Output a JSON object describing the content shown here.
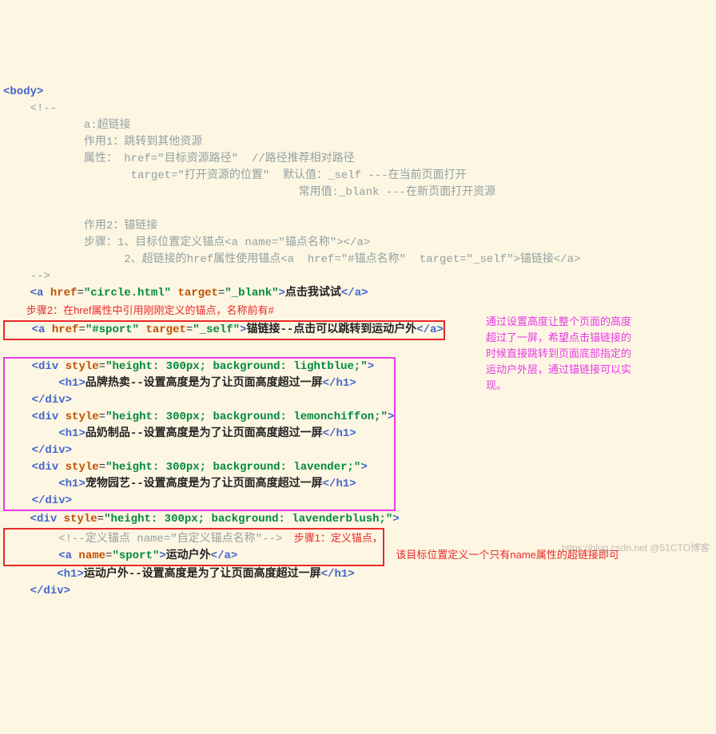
{
  "c1": "<body>",
  "cm1_l1": "    <!--",
  "cm1_l2": "            a:超链接",
  "cm1_l3": "            作用1：跳转到其他资源",
  "cm1_l4": "            属性： href=\"目标资源路径\"  //路径推荐相对路径",
  "cm1_l5": "                   target=\"打开资源的位置\"  默认值：_self ---在当前页面打开",
  "cm1_l6": "                                            常用值:_blank ---在新页面打开资源",
  "cm1_l7": " ",
  "cm1_l8": "            作用2：锚链接",
  "cm1_l9": "            步骤：1、目标位置定义锚点<a name=\"锚点名称\"></a>",
  "cm1_l10": "                  2、超链接的href属性使用锚点<a  href=\"#锚点名称\"  target=\"_self\">锚链接</a>",
  "cm1_l11": "    -->",
  "a1_pre": "    ",
  "a1_open": "<",
  "a1_tag": "a",
  "a1_attr1": " href",
  "a1_eq1": "=",
  "a1_v1": "\"circle.html\"",
  "a1_attr2": " target",
  "a1_eq2": "=",
  "a1_v2": "\"_blank\"",
  "a1_gt": ">",
  "a1_txt": "点击我试试",
  "a1_close": "</a>",
  "annot_top": "        步骤2：在href属性中引用刚刚定义的锚点，名称前有#",
  "a2_pre": "    ",
  "a2_open": "<",
  "a2_tag": "a",
  "a2_attr1": " href",
  "a2_eq1": "=",
  "a2_v1": "\"#sport\"",
  "a2_attr2": " target",
  "a2_eq2": "=",
  "a2_v2": "\"_self\"",
  "a2_gt": ">",
  "a2_txt": "锚链接--点击可以跳转到运动户外",
  "a2_close": "</a>",
  "d1_pre": "    ",
  "d1_open": "<",
  "d1_tag": "div",
  "d1_attr": " style",
  "d1_eq": "=",
  "d1_v": "\"height: 300px; background: lightblue;\"",
  "d1_gt": ">",
  "d1h_pre": "        ",
  "d1h_open": "<",
  "d1h_tag": "h1",
  "d1h_gt": ">",
  "d1h_txt": "品牌热卖--设置高度是为了让页面高度超过一屏",
  "d1h_close": "</h1>",
  "d1_close_pre": "    ",
  "d1_close": "</div>",
  "d2_pre": "    ",
  "d2_open": "<",
  "d2_tag": "div",
  "d2_attr": " style",
  "d2_eq": "=",
  "d2_v": "\"height: 300px; background: lemonchiffon;\"",
  "d2_gt": ">",
  "d2h_pre": "        ",
  "d2h_open": "<",
  "d2h_tag": "h1",
  "d2h_gt": ">",
  "d2h_txt": "品奶制品--设置高度是为了让页面高度超过一屏",
  "d2h_close": "</h1>",
  "d2_close_pre": "    ",
  "d2_close": "</div>",
  "d3_pre": "    ",
  "d3_open": "<",
  "d3_tag": "div",
  "d3_attr": " style",
  "d3_eq": "=",
  "d3_v": "\"height: 300px; background: lavender;\"",
  "d3_gt": ">",
  "d3h_pre": "        ",
  "d3h_open": "<",
  "d3h_tag": "h1",
  "d3h_gt": ">",
  "d3h_txt": "宠物园艺--设置高度是为了让页面高度超过一屏",
  "d3h_close": "</h1>",
  "d3_close_pre": "    ",
  "d3_close": "</div>",
  "d4_pre": "    ",
  "d4_open": "<",
  "d4_tag": "div",
  "d4_attr": " style",
  "d4_eq": "=",
  "d4_v": "\"height: 300px; background: lavenderblush;\"",
  "d4_gt": ">",
  "cm2_pre": "        ",
  "cm2": "<!--定义锚点 name=\"自定义锚点名称\"-->",
  "an_pre": "        ",
  "an_open": "<",
  "an_tag": "a",
  "an_attr": " name",
  "an_eq": "=",
  "an_v": "\"sport\"",
  "an_gt": ">",
  "an_txt": "运动户外",
  "an_close": "</a>",
  "annot_bot_l1": "    步骤1：定义锚点，",
  "annot_bot_l2": "    该目标位置定义一个只有name属性的超链接即可",
  "d4h_pre": "        ",
  "d4h_open": "<",
  "d4h_tag": "h1",
  "d4h_gt": ">",
  "d4h_txt": "运动户外--设置高度是为了让页面高度超过一屏",
  "d4h_close": "</h1>",
  "d4_close_pre": "    ",
  "d4_close": "</div>",
  "side_note": "通过设置高度让整个页面的高度超过了一屏，希望点击锚链接的时候直接跳转到页面底部指定的运动户外层，通过锚链接可以实现。",
  "wm": "https://blog.csdn.net @51CTO博客"
}
